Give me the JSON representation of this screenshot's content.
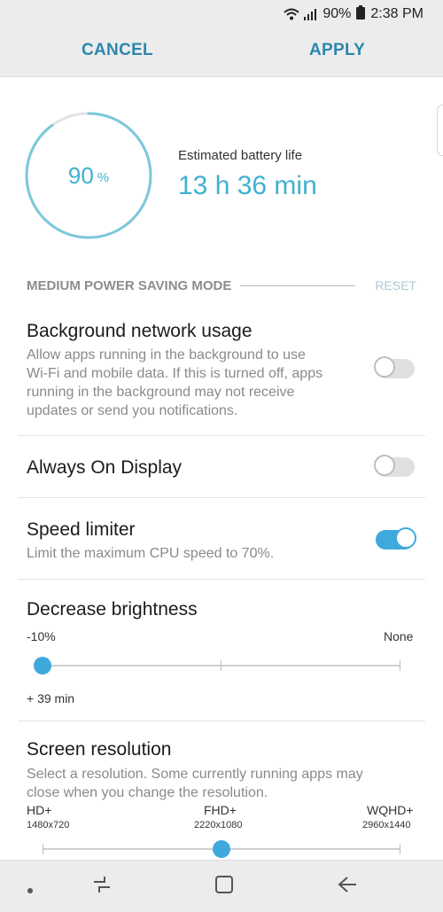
{
  "status_bar": {
    "battery_percent": "90%",
    "time": "2:38 PM",
    "icons": [
      "wifi-icon",
      "signal-icon",
      "battery-icon"
    ]
  },
  "action_bar": {
    "cancel_label": "CANCEL",
    "apply_label": "APPLY"
  },
  "battery": {
    "percent_value": "90",
    "percent_unit": "%",
    "ring_fill": 0.9,
    "estimate_label": "Estimated battery life",
    "estimate_value": "13 h 36 min"
  },
  "mode": {
    "title": "MEDIUM POWER SAVING MODE",
    "reset_label": "RESET"
  },
  "settings": {
    "background_network": {
      "title": "Background network usage",
      "description_lines": [
        "Allow apps running in the background to use",
        "Wi-Fi and mobile data. If this is turned off, apps",
        "running in the background may not receive",
        "updates or send you notifications."
      ],
      "enabled": false
    },
    "always_on_display": {
      "title": "Always On Display",
      "enabled": false
    },
    "speed_limiter": {
      "title": "Speed limiter",
      "description": "Limit the maximum CPU speed to 70%.",
      "enabled": true
    },
    "brightness": {
      "title": "Decrease brightness",
      "min_label": "-10%",
      "max_label": "None",
      "extra_time": "+ 39 min",
      "selected_step": 0
    },
    "resolution": {
      "title": "Screen resolution",
      "description_lines": [
        "Select a resolution. Some currently running apps may",
        "close when you change the resolution."
      ],
      "options": [
        {
          "name": "HD+",
          "size": "1480x720"
        },
        {
          "name": "FHD+",
          "size": "2220x1080"
        },
        {
          "name": "WQHD+",
          "size": "2960x1440"
        }
      ],
      "selected_index": 1
    }
  },
  "nav_bar": {
    "icons": [
      "dot-icon",
      "recents-icon",
      "home-icon",
      "back-icon"
    ]
  },
  "colors": {
    "accent": "#3fb1cf",
    "toggle_on": "#3fa9dd",
    "action_text": "#2b87ae"
  }
}
